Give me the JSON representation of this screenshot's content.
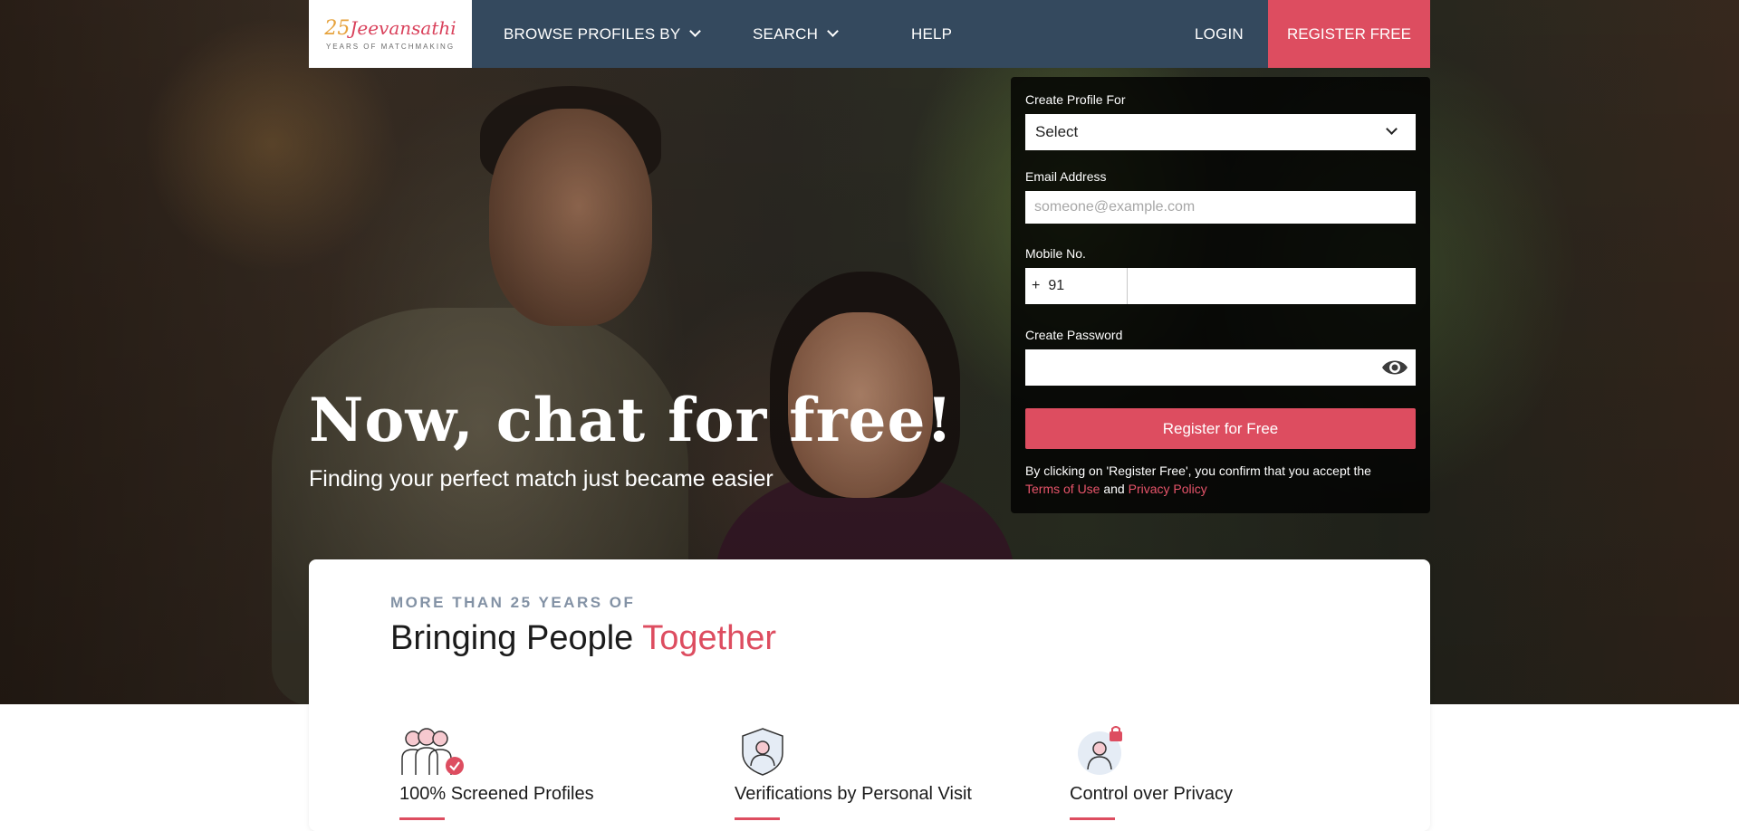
{
  "logo": {
    "number": "25",
    "brand": "Jeevansathi",
    "tagline": "YEARS OF MATCHMAKING"
  },
  "nav": {
    "browse": "BROWSE PROFILES BY",
    "search": "SEARCH",
    "help": "HELP",
    "login": "LOGIN",
    "register": "REGISTER FREE"
  },
  "hero": {
    "title": "Now, chat for free!",
    "subtitle": "Finding your perfect match just became easier"
  },
  "form": {
    "profile_for_label": "Create Profile For",
    "profile_for_value": "Select",
    "email_label": "Email Address",
    "email_placeholder": "someone@example.com",
    "mobile_label": "Mobile No.",
    "country_plus": "+",
    "country_code": "91",
    "password_label": "Create Password",
    "submit": "Register for Free",
    "terms_text": "By clicking on 'Register Free', you confirm that you accept the",
    "terms_link": "Terms of Use",
    "and_text": "and",
    "privacy_link": "Privacy Policy"
  },
  "about": {
    "kicker": "MORE THAN 25 YEARS OF",
    "title_main": "Bringing People",
    "title_accent": "Together"
  },
  "features": [
    {
      "label": "100% Screened Profiles",
      "icon": "screened-profiles-icon"
    },
    {
      "label": "Verifications by Personal Visit",
      "icon": "verification-shield-icon"
    },
    {
      "label": "Control over Privacy",
      "icon": "privacy-lock-icon"
    }
  ],
  "colors": {
    "accent": "#dd4d60",
    "nav": "#34495e"
  }
}
